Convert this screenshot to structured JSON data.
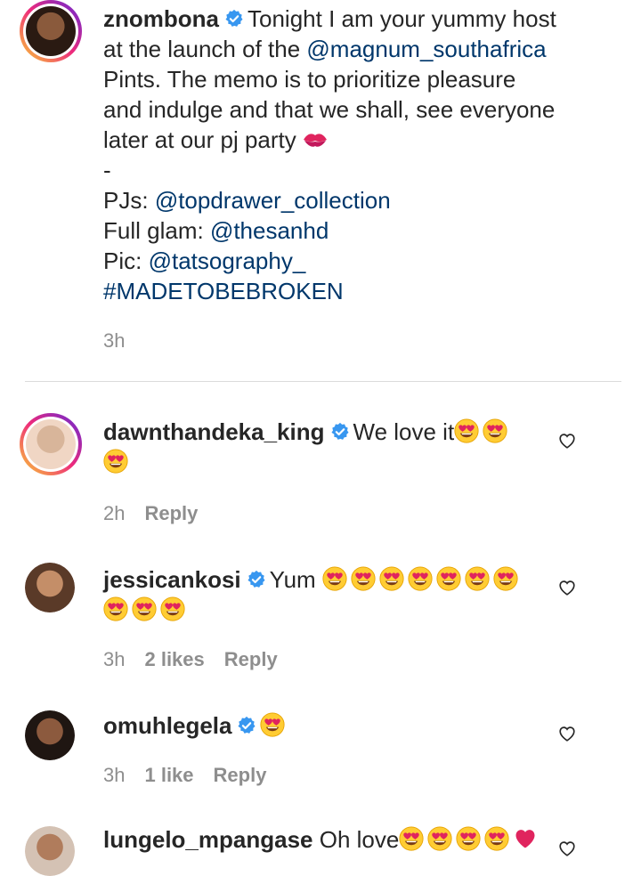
{
  "post": {
    "username": "znombona",
    "caption_lines": [
      "Tonight I am your yummy host",
      "at the launch of the",
      "Pints. The memo is to prioritize pleasure",
      "and indulge and that we shall, see everyone",
      "later at our pj party",
      "-",
      "PJs:",
      "Full glam:",
      "Pic:"
    ],
    "mention_magnum": "@magnum_southafrica",
    "mention_topdrawer": "@topdrawer_collection",
    "mention_thesanhd": "@thesanhd",
    "mention_tatso": "@tatsography_",
    "hashtag": "#MADETOBEBROKEN",
    "time": "3h"
  },
  "comments": [
    {
      "username": "dawnthandeka_king",
      "text": "We love it",
      "time": "2h",
      "likes": "",
      "reply": "Reply"
    },
    {
      "username": "jessicankosi",
      "text": "Yum",
      "time": "3h",
      "likes": "2 likes",
      "reply": "Reply"
    },
    {
      "username": "omuhlegela",
      "text": "",
      "time": "3h",
      "likes": "1 like",
      "reply": "Reply"
    },
    {
      "username": "lungelo_mpangase",
      "text": "Oh love",
      "time": "",
      "likes": "",
      "reply": ""
    }
  ],
  "colors": {
    "link": "#00376b",
    "verified": "#3897f0",
    "meta": "#8e8e8e",
    "heart_red": "#e0245e"
  }
}
